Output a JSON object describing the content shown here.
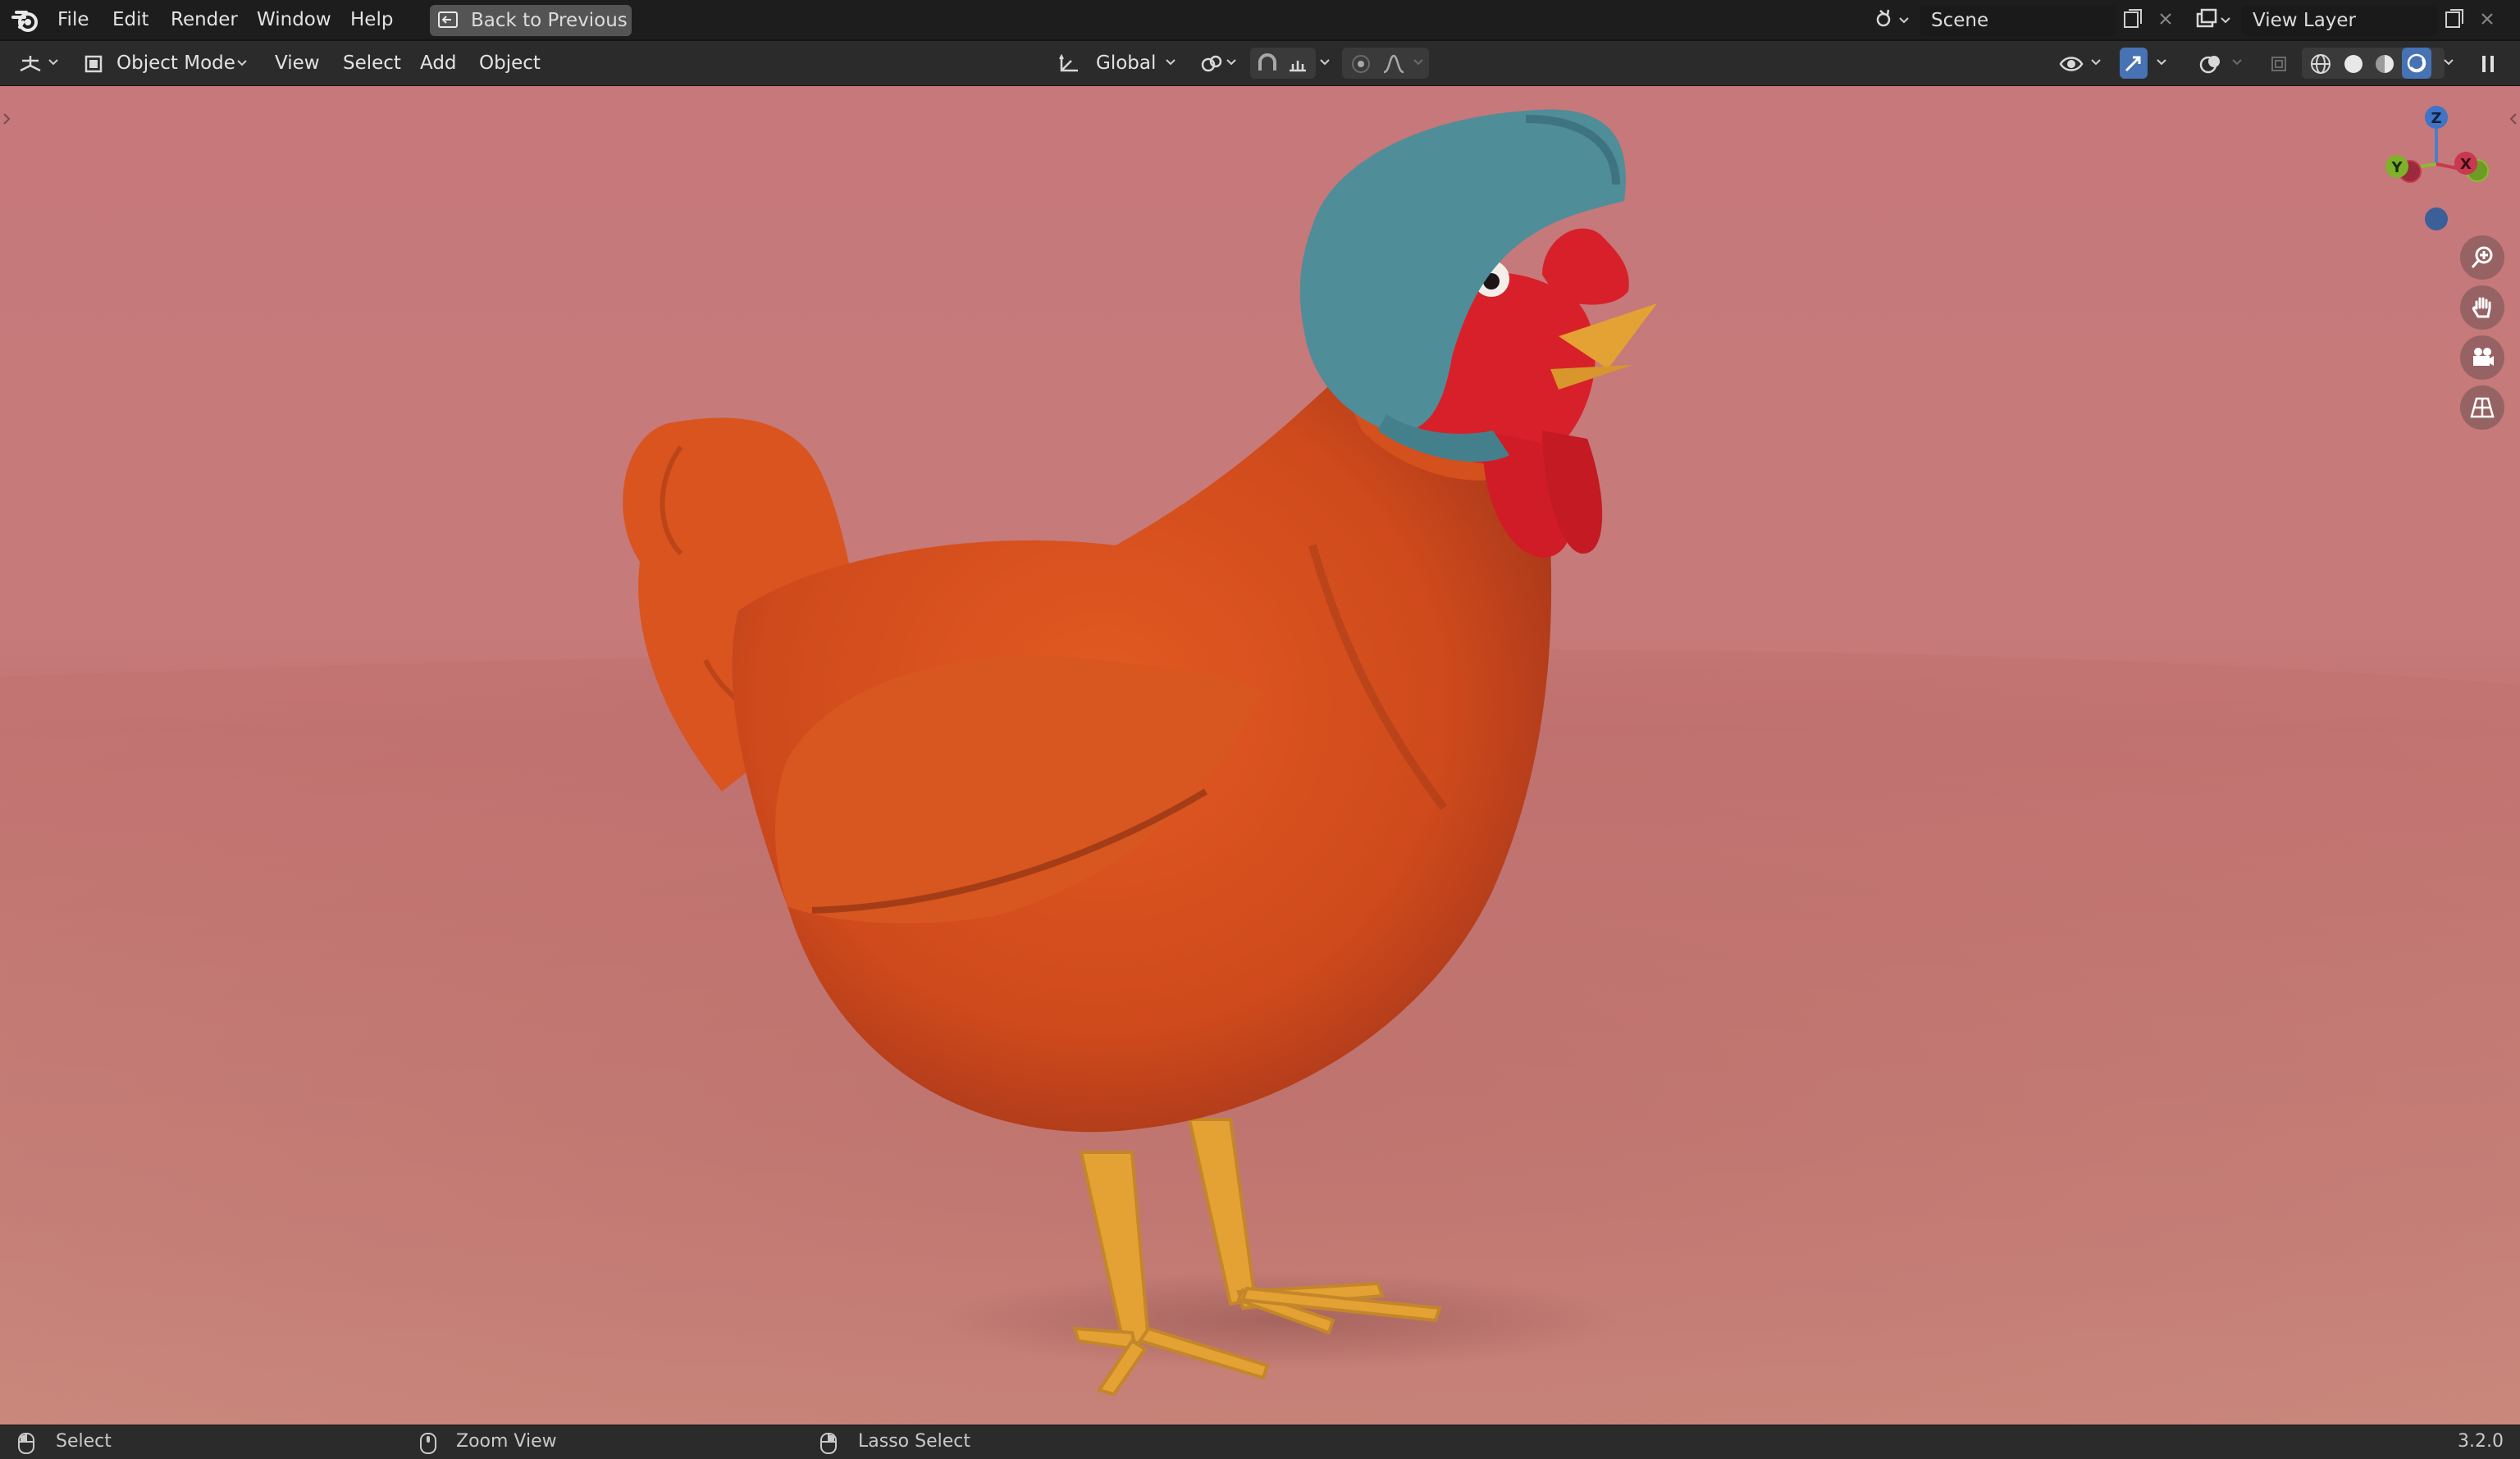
{
  "topbar": {
    "menus": [
      "File",
      "Edit",
      "Render",
      "Window",
      "Help"
    ],
    "back_button": "Back to Previous",
    "scene": "Scene",
    "view_layer": "View Layer"
  },
  "header": {
    "mode": "Object Mode",
    "menus": [
      "View",
      "Select",
      "Add",
      "Object"
    ],
    "orientation": "Global"
  },
  "gizmo": {
    "z": "Z",
    "y": "Y",
    "x": "X"
  },
  "status": {
    "select": "Select",
    "zoom": "Zoom View",
    "lasso": "Lasso Select",
    "version": "3.2.0"
  },
  "colors": {
    "accent_blue": "#4772b3",
    "hen_body": "#cf4a1c",
    "bonnet": "#4f8d98",
    "comb": "#d8202a",
    "beak_legs": "#e3a233",
    "background": "#c6787a"
  }
}
